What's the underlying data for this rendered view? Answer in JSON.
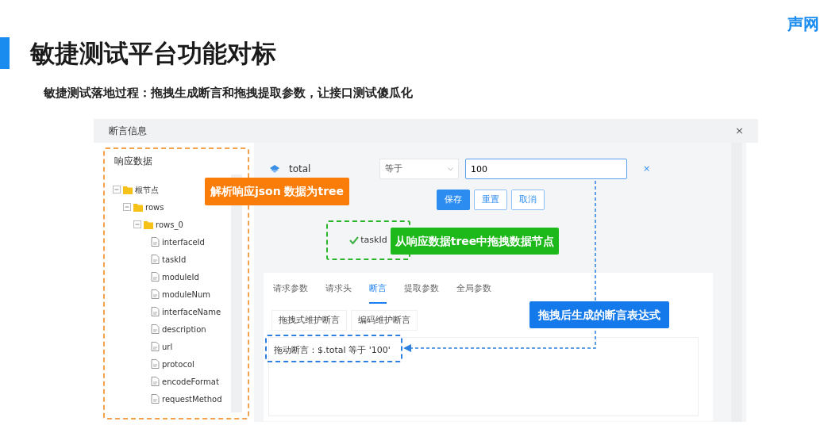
{
  "logo": "声网",
  "title": "敏捷测试平台功能对标",
  "subtitle": "敏捷测试落地过程：拖拽生成断言和拖拽提取参数，让接口测试傻瓜化",
  "dialog": {
    "title": "断言信息",
    "close": "×",
    "tree": {
      "title": "响应数据",
      "nodes": [
        {
          "label": "根节点",
          "kind": "folder",
          "expanded": true,
          "children": [
            {
              "label": "rows",
              "kind": "folder",
              "expanded": true,
              "children": [
                {
                  "label": "rows_0",
                  "kind": "folder",
                  "expanded": true,
                  "children": [
                    {
                      "label": "interfaceId",
                      "kind": "leaf"
                    },
                    {
                      "label": "taskId",
                      "kind": "leaf"
                    },
                    {
                      "label": "moduleId",
                      "kind": "leaf"
                    },
                    {
                      "label": "moduleNum",
                      "kind": "leaf"
                    },
                    {
                      "label": "interfaceName",
                      "kind": "leaf"
                    },
                    {
                      "label": "description",
                      "kind": "leaf"
                    },
                    {
                      "label": "url",
                      "kind": "leaf"
                    },
                    {
                      "label": "protocol",
                      "kind": "leaf"
                    },
                    {
                      "label": "encodeFormat",
                      "kind": "leaf"
                    },
                    {
                      "label": "requestMethod",
                      "kind": "leaf"
                    }
                  ]
                }
              ]
            }
          ]
        }
      ]
    },
    "editor": {
      "field": "total",
      "operator": "等于",
      "value": "100",
      "clear": "×",
      "buttons": [
        {
          "label": "保存",
          "primary": true
        },
        {
          "label": "重置",
          "primary": false
        },
        {
          "label": "取消",
          "primary": false
        }
      ]
    },
    "dragged_node": "taskId",
    "tabs": [
      {
        "label": "请求参数",
        "selected": false
      },
      {
        "label": "请求头",
        "selected": false
      },
      {
        "label": "断言",
        "selected": true
      },
      {
        "label": "提取参数",
        "selected": false
      },
      {
        "label": "全局参数",
        "selected": false
      }
    ],
    "subtabs": [
      "拖拽式维护断言",
      "编码维护断言"
    ],
    "assertion_text": "拖动断言：$.total 等于 '100'"
  },
  "callouts": [
    {
      "text": "解析响应json 数据为tree",
      "color": "#fa7d0a"
    },
    {
      "text": "从响应数据tree中拖拽数据节点",
      "color": "#1db81a"
    },
    {
      "text": "拖拽后生成的断言表达式",
      "color": "#1479ea"
    }
  ]
}
